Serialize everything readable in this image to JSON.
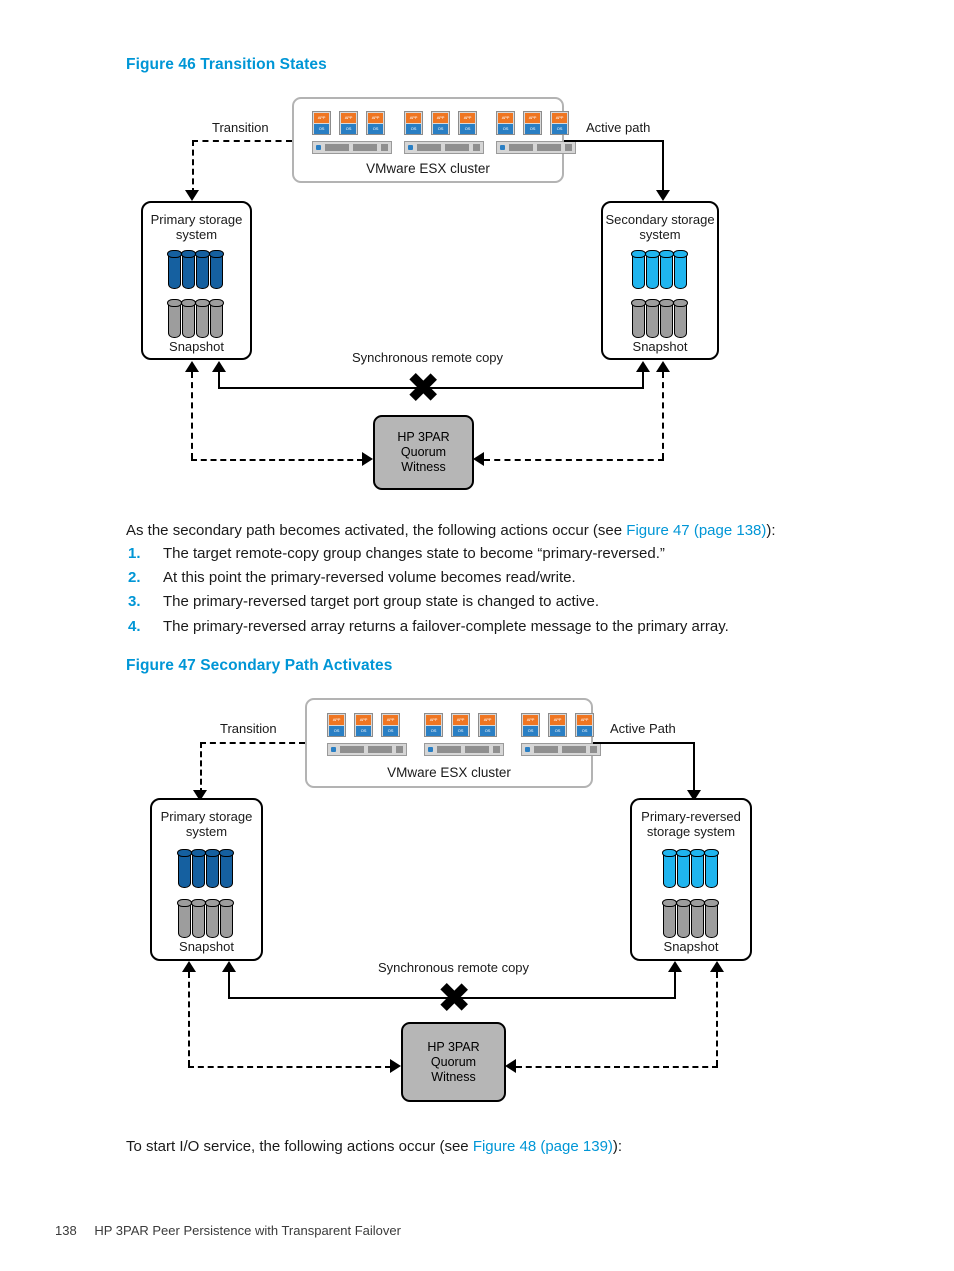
{
  "figure46": {
    "title": "Figure 46 Transition States",
    "esx_cluster_label": "VMware ESX cluster",
    "vm_app_label": "APP",
    "vm_os_label": "OS",
    "transition_label": "Transition",
    "active_path_label": "Active path",
    "sync_label": "Synchronous remote copy",
    "primary": {
      "title_line1": "Primary storage",
      "title_line2": "system",
      "snapshot_label": "Snapshot",
      "volume_color": "#1560a0",
      "snapshot_color": "#9d9d9d"
    },
    "secondary": {
      "title_line1": "Secondary storage",
      "title_line2": "system",
      "snapshot_label": "Snapshot",
      "volume_color": "#1fb5ef",
      "snapshot_color": "#9d9d9d"
    },
    "quorum": {
      "line1": "HP 3PAR",
      "line2": "Quorum",
      "line3": "Witness",
      "fill_color": "#b6b6b6"
    }
  },
  "paragraph1": {
    "before": "As the secondary path becomes activated, the following actions occur (see ",
    "link": "Figure 47 (page 138)",
    "after": "):"
  },
  "steps": [
    {
      "num": "1.",
      "text": "The target remote-copy group changes state to become “primary-reversed.”"
    },
    {
      "num": "2.",
      "text": "At this point the primary-reversed volume becomes read/write."
    },
    {
      "num": "3.",
      "text": "The primary-reversed target port group state is changed to active."
    },
    {
      "num": "4.",
      "text": "The primary-reversed array returns a failover-complete message to the primary array."
    }
  ],
  "figure47": {
    "title": "Figure 47 Secondary Path Activates",
    "esx_cluster_label": "VMware ESX cluster",
    "vm_app_label": "APP",
    "vm_os_label": "OS",
    "transition_label": "Transition",
    "active_path_label": "Active Path",
    "sync_label": "Synchronous remote copy",
    "primary": {
      "title_line1": "Primary storage",
      "title_line2": "system",
      "snapshot_label": "Snapshot",
      "volume_color": "#1560a0",
      "snapshot_color": "#9d9d9d"
    },
    "secondary": {
      "title_line1": "Primary-reversed",
      "title_line2": "storage system",
      "snapshot_label": "Snapshot",
      "volume_color": "#1fb5ef",
      "snapshot_color": "#9d9d9d"
    },
    "quorum": {
      "line1": "HP 3PAR",
      "line2": "Quorum",
      "line3": "Witness",
      "fill_color": "#b6b6b6"
    }
  },
  "paragraph2": {
    "before": "To start I/O service, the following actions occur (see ",
    "link": "Figure 48 (page 139)",
    "after": "):"
  },
  "footer": {
    "page_number": "138",
    "chapter_title": "HP 3PAR Peer Persistence with Transparent Failover"
  },
  "accent_color": "#0096d6"
}
